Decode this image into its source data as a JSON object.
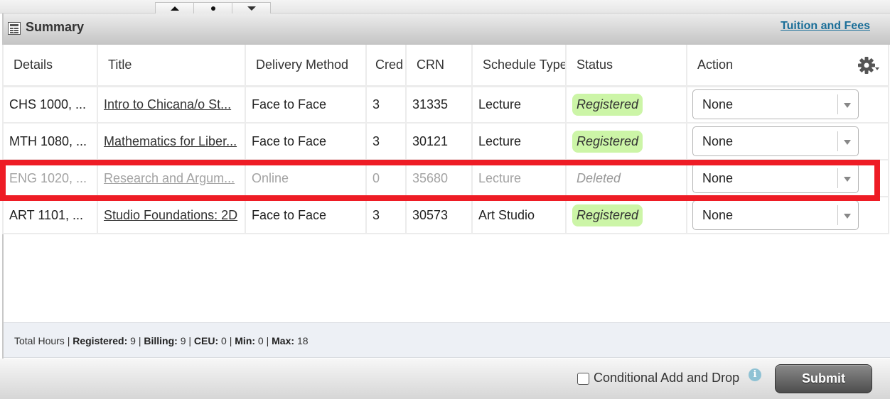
{
  "splitter": {
    "buttons": [
      {
        "name": "move-up",
        "icon": "triangle-up-icon"
      },
      {
        "name": "center",
        "icon": "dot-icon"
      },
      {
        "name": "move-down",
        "icon": "triangle-down-icon"
      }
    ]
  },
  "panel": {
    "title": "Summary",
    "title_icon": "table-icon",
    "tuition_link": "Tuition and Fees",
    "settings_icon": "gear-icon"
  },
  "table": {
    "columns": [
      "Details",
      "Title",
      "Delivery Method",
      "Cred",
      "CRN",
      "Schedule Type",
      "Status",
      "Action"
    ],
    "rows": [
      {
        "details": "CHS 1000, ...",
        "title": "Intro to Chicana/o St...",
        "delivery": "Face to Face",
        "credits": "3",
        "crn": "31335",
        "schedule_type": "Lecture",
        "status": "Registered",
        "action": "None"
      },
      {
        "details": "MTH 1080, ...",
        "title": "Mathematics for Liber...",
        "delivery": "Face to Face",
        "credits": "3",
        "crn": "30121",
        "schedule_type": "Lecture",
        "status": "Registered",
        "action": "None"
      },
      {
        "details": "ENG 1020, ...",
        "title": "Research and Argum...",
        "delivery": "Online",
        "credits": "0",
        "crn": "35680",
        "schedule_type": "Lecture",
        "status": "Deleted",
        "action": "None"
      },
      {
        "details": "ART 1101, ...",
        "title": "Studio Foundations: 2D",
        "delivery": "Face to Face",
        "credits": "3",
        "crn": "30573",
        "schedule_type": "Art Studio",
        "status": "Registered",
        "action": "None"
      }
    ]
  },
  "totals": {
    "label": "Total Hours",
    "registered_label": "Registered:",
    "registered": "9",
    "billing_label": "Billing:",
    "billing": "9",
    "ceu_label": "CEU:",
    "ceu": "0",
    "min_label": "Min:",
    "min": "0",
    "max_label": "Max:",
    "max": "18"
  },
  "footer": {
    "conditional_label": "Conditional Add and Drop",
    "conditional_checked": false,
    "info_icon": "i",
    "submit_label": "Submit"
  },
  "colors": {
    "registered_badge": "#ccf5a7",
    "link": "#1a6e98",
    "highlight": "#ee1c25"
  }
}
